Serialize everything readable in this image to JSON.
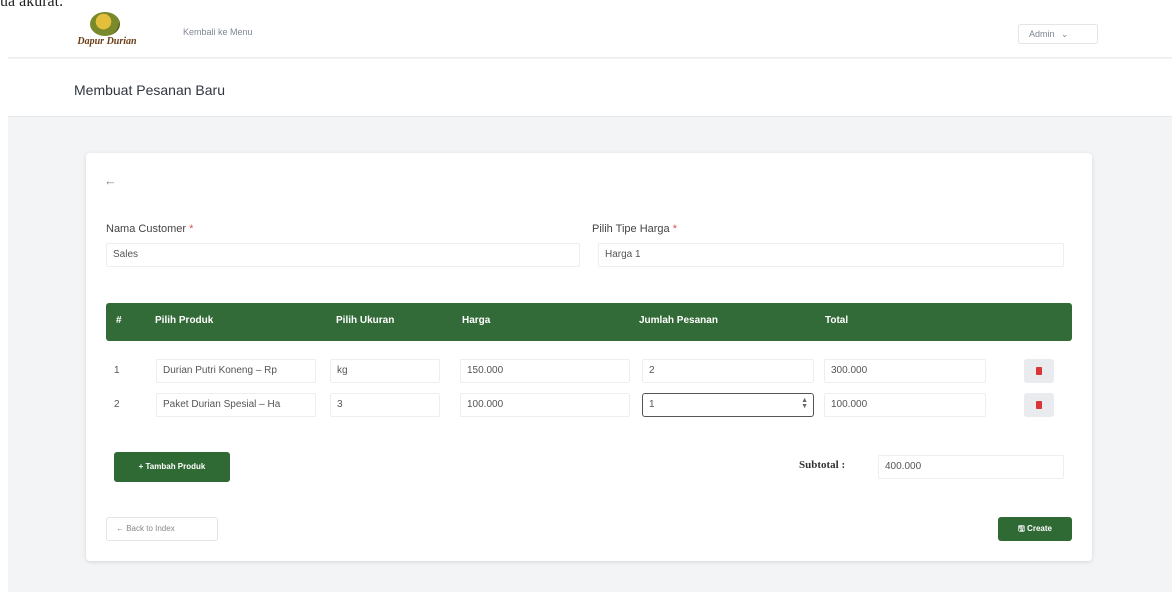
{
  "caption": "ua akurat.",
  "navbar": {
    "logo_text": "Dapur Durian",
    "back_link": "Kembali ke Menu",
    "user_menu": "Admin",
    "user_menu_caret": "⌄"
  },
  "page": {
    "title": "Membuat Pesanan Baru"
  },
  "form": {
    "back_icon": "←",
    "customer_label": "Nama Customer",
    "customer_value": "Sales",
    "price_type_label": "Pilih Tipe Harga",
    "price_type_value": "Harga 1",
    "required_mark": "*"
  },
  "table": {
    "headers": [
      "#",
      "Pilih Produk",
      "Pilih Ukuran",
      "Harga",
      "Jumlah Pesanan",
      "Total"
    ],
    "rows": [
      {
        "no": "1",
        "product": "Durian Putri Koneng – Rp",
        "size": "kg",
        "price": "150.000",
        "qty": "2",
        "total": "300.000"
      },
      {
        "no": "2",
        "product": "Paket Durian Spesial – Ha",
        "size": "3",
        "price": "100.000",
        "qty": "1",
        "total": "100.000"
      }
    ],
    "delete_icon": "trash-icon",
    "colors": {
      "header_bg": "#336b38",
      "delete_icon": "#d93636"
    }
  },
  "actions": {
    "add_product": "+ Tambah Produk",
    "subtotal_label": "Subtotal :",
    "subtotal_value": "400.000",
    "back_to_index": "← Back to Index",
    "create": "🖫 Create"
  }
}
